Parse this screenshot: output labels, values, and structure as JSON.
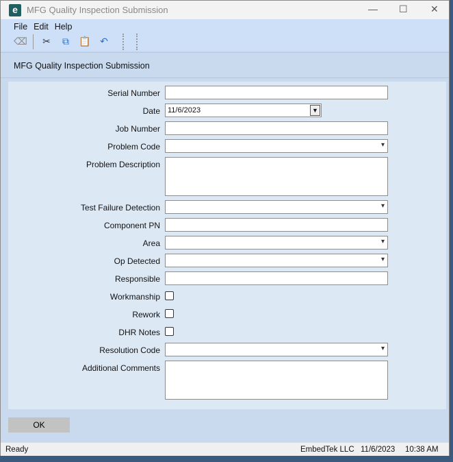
{
  "window": {
    "title": "MFG Quality Inspection Submission",
    "app_icon": "e"
  },
  "menu": [
    "File",
    "Edit",
    "Help"
  ],
  "toolbar": [
    "eraser-icon",
    "cut-icon",
    "copy-icon",
    "paste-icon",
    "undo-icon"
  ],
  "header": {
    "title": "MFG Quality Inspection Submission"
  },
  "form": {
    "serial_number": {
      "label": "Serial Number",
      "value": ""
    },
    "date": {
      "label": "Date",
      "value": "11/6/2023"
    },
    "job_number": {
      "label": "Job Number",
      "value": ""
    },
    "problem_code": {
      "label": "Problem Code",
      "value": ""
    },
    "problem_description": {
      "label": "Problem Description",
      "value": ""
    },
    "test_failure_detection": {
      "label": "Test Failure Detection",
      "value": ""
    },
    "component_pn": {
      "label": "Component PN",
      "value": ""
    },
    "area": {
      "label": "Area",
      "value": ""
    },
    "op_detected": {
      "label": "Op Detected",
      "value": ""
    },
    "responsible": {
      "label": "Responsible",
      "value": ""
    },
    "workmanship": {
      "label": "Workmanship",
      "checked": false
    },
    "rework": {
      "label": "Rework",
      "checked": false
    },
    "dhr_notes": {
      "label": "DHR Notes",
      "checked": false
    },
    "resolution_code": {
      "label": "Resolution Code",
      "value": ""
    },
    "additional_comments": {
      "label": "Additional Comments",
      "value": ""
    }
  },
  "ok_label": "OK",
  "status": {
    "text": "Ready",
    "company": "EmbedTek LLC",
    "date": "11/6/2023",
    "time": "10:38 AM"
  }
}
